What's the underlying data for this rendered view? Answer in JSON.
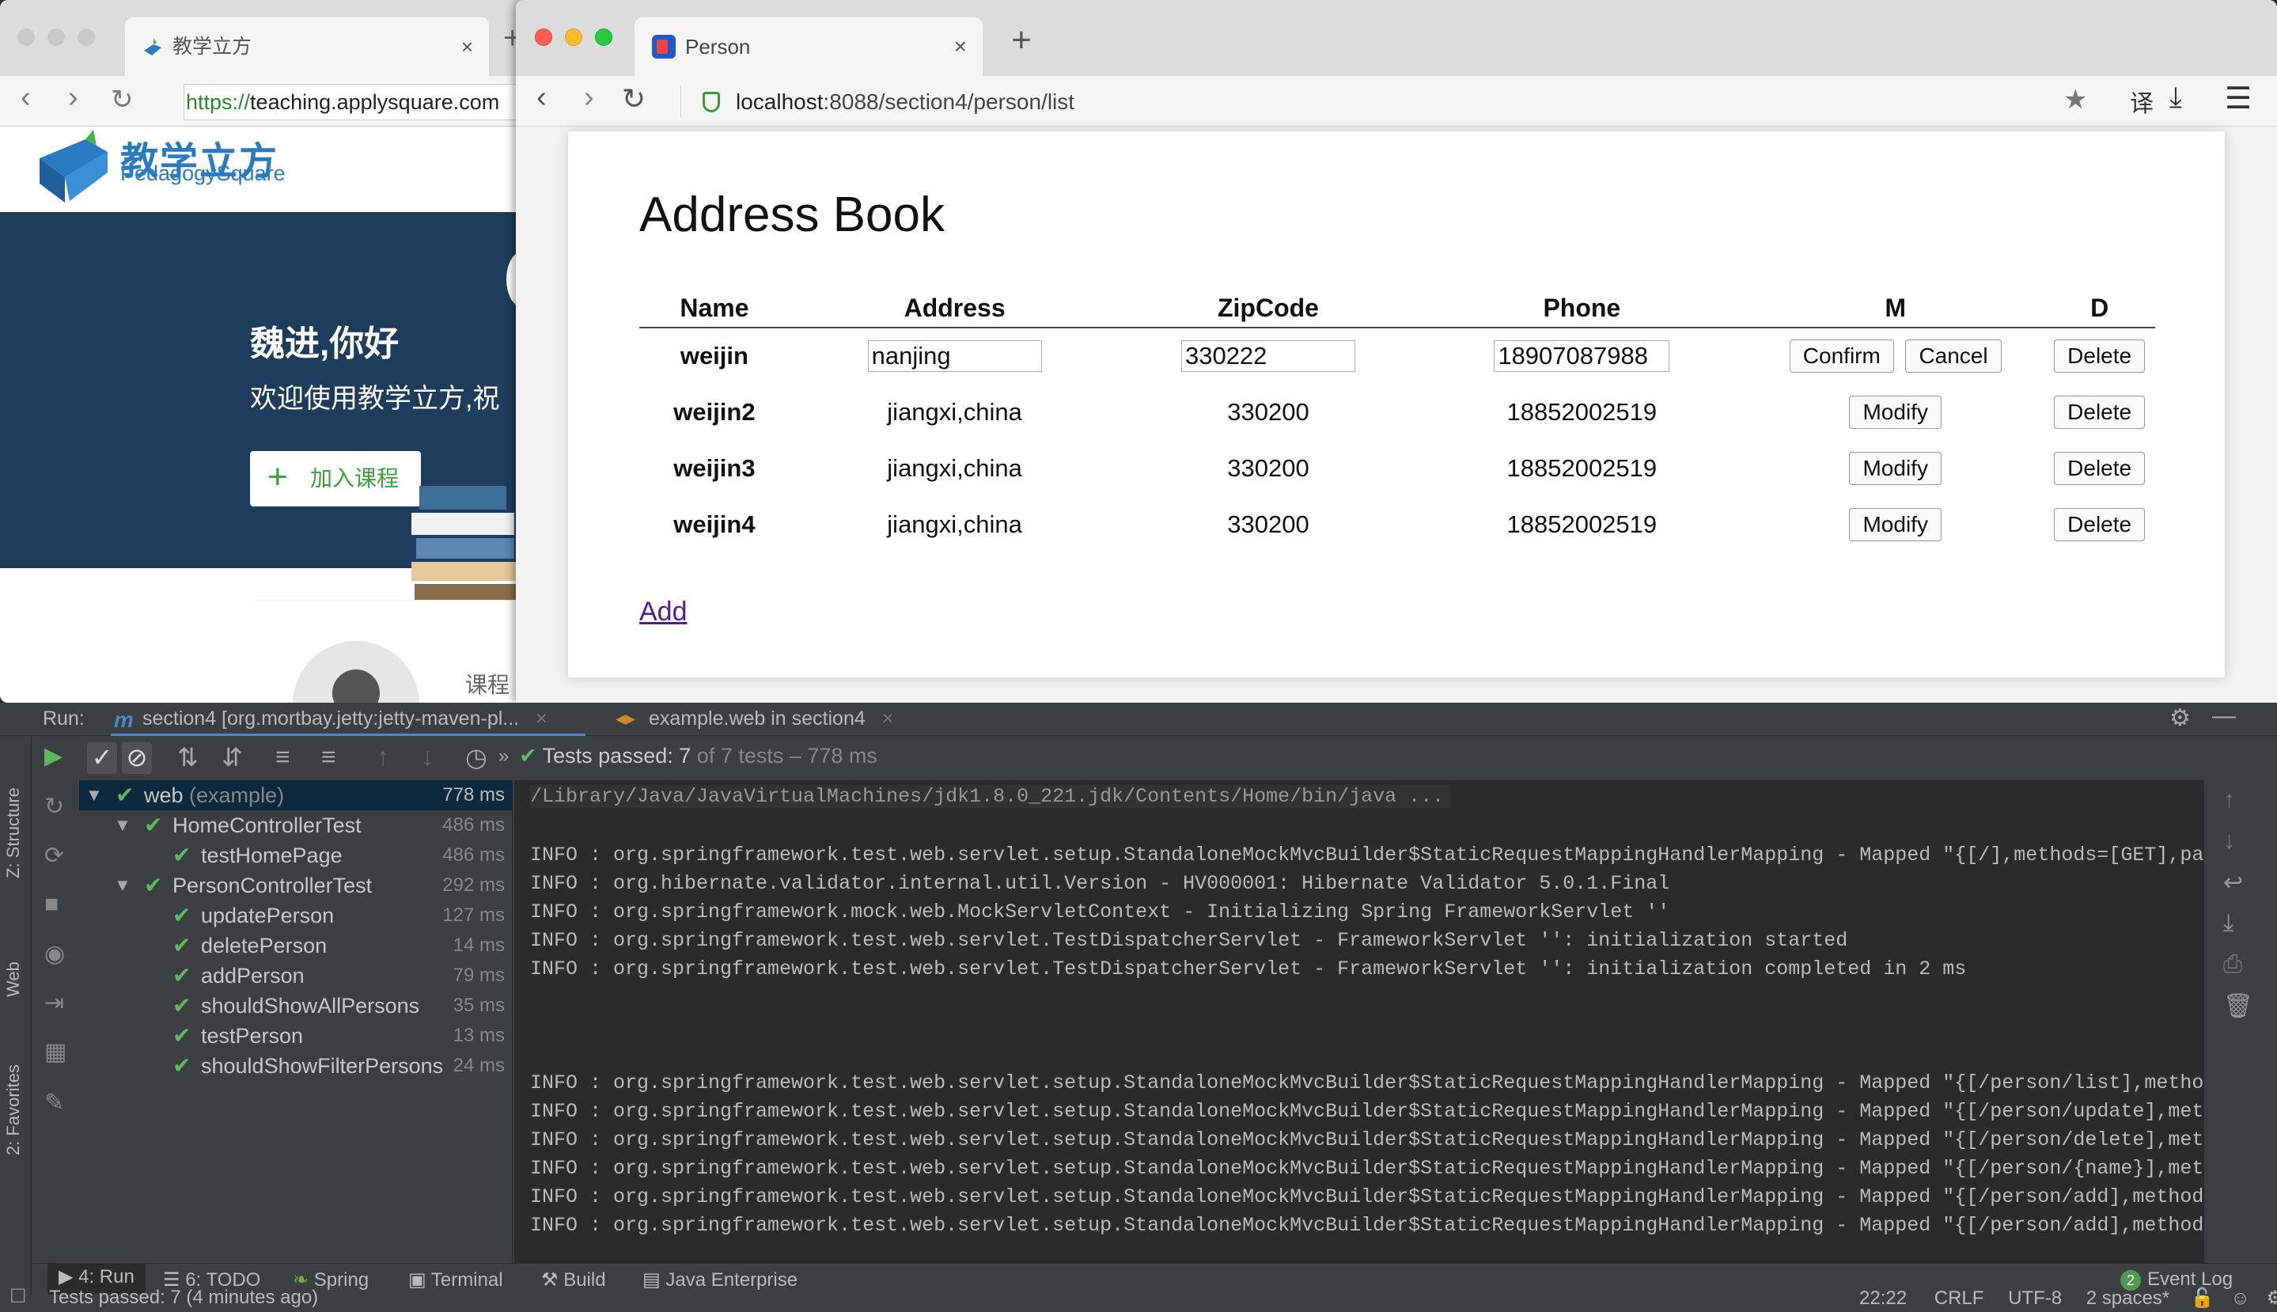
{
  "back_browser": {
    "tab_title": "教学立方",
    "tab_close": "×",
    "url_protocol": "https://",
    "url_rest": "teaching.applysquare.com",
    "logo_cn": "教学立方",
    "logo_en": "PedagogySquare",
    "greeting": "魏进,你好",
    "welcome": "欢迎使用教学立方,祝",
    "join_button": "加入课程",
    "course_label": "课程"
  },
  "front_browser": {
    "tab_title": "Person",
    "tab_close": "×",
    "new_tab": "+",
    "url_host": "localhost",
    "url_path": ":8088/section4/person/list",
    "translate_label": "译"
  },
  "address_book": {
    "title": "Address Book",
    "columns": [
      "Name",
      "Address",
      "ZipCode",
      "Phone",
      "M",
      "D"
    ],
    "editing_row": {
      "name": "weijin",
      "address": "nanjing",
      "zipcode": "330222",
      "phone": "18907087988",
      "confirm_label": "Confirm",
      "cancel_label": "Cancel",
      "delete_label": "Delete"
    },
    "rows": [
      {
        "name": "weijin2",
        "address": "jiangxi,china",
        "zipcode": "330200",
        "phone": "18852002519",
        "modify": "Modify",
        "delete": "Delete"
      },
      {
        "name": "weijin3",
        "address": "jiangxi,china",
        "zipcode": "330200",
        "phone": "18852002519",
        "modify": "Modify",
        "delete": "Delete"
      },
      {
        "name": "weijin4",
        "address": "jiangxi,china",
        "zipcode": "330200",
        "phone": "18852002519",
        "modify": "Modify",
        "delete": "Delete"
      }
    ],
    "add_link": "Add"
  },
  "ide": {
    "run_label": "Run:",
    "run_tab_1": "section4 [org.mortbay.jetty:jetty-maven-pl...",
    "run_tab_2": "example.web in section4",
    "tests_passed_label": "Tests passed:",
    "tests_passed_count": "7",
    "tests_passed_rest": "of 7 tests – 778 ms",
    "left_tabs": [
      "Z: Structure",
      "Web",
      "2: Favorites"
    ],
    "tree": [
      {
        "label": "web",
        "sub": " (example)",
        "duration": "778 ms",
        "level": 0,
        "expanded": true
      },
      {
        "label": "HomeControllerTest",
        "duration": "486 ms",
        "level": 1,
        "expanded": true
      },
      {
        "label": "testHomePage",
        "duration": "486 ms",
        "level": 2
      },
      {
        "label": "PersonControllerTest",
        "duration": "292 ms",
        "level": 1,
        "expanded": true
      },
      {
        "label": "updatePerson",
        "duration": "127 ms",
        "level": 2
      },
      {
        "label": "deletePerson",
        "duration": "14 ms",
        "level": 2
      },
      {
        "label": "addPerson",
        "duration": "79 ms",
        "level": 2
      },
      {
        "label": "shouldShowAllPersons",
        "duration": "35 ms",
        "level": 2
      },
      {
        "label": "testPerson",
        "duration": "13 ms",
        "level": 2
      },
      {
        "label": "shouldShowFilterPersons",
        "duration": "24 ms",
        "level": 2
      }
    ],
    "console_path": "/Library/Java/JavaVirtualMachines/jdk1.8.0_221.jdk/Contents/Home/bin/java ...",
    "console_block_1": [
      "INFO : org.springframework.test.web.servlet.setup.StandaloneMockMvcBuilder$StaticRequestMappingHandlerMapping - Mapped \"{[/],methods=[GET],params=[],he",
      "INFO : org.hibernate.validator.internal.util.Version - HV000001: Hibernate Validator 5.0.1.Final",
      "INFO : org.springframework.mock.web.MockServletContext - Initializing Spring FrameworkServlet ''",
      "INFO : org.springframework.test.web.servlet.TestDispatcherServlet - FrameworkServlet '': initialization started",
      "INFO : org.springframework.test.web.servlet.TestDispatcherServlet - FrameworkServlet '': initialization completed in 2 ms"
    ],
    "console_block_2": [
      "INFO : org.springframework.test.web.servlet.setup.StandaloneMockMvcBuilder$StaticRequestMappingHandlerMapping - Mapped \"{[/person/list],methods=[GET],p",
      "INFO : org.springframework.test.web.servlet.setup.StandaloneMockMvcBuilder$StaticRequestMappingHandlerMapping - Mapped \"{[/person/update],methods=[POST",
      "INFO : org.springframework.test.web.servlet.setup.StandaloneMockMvcBuilder$StaticRequestMappingHandlerMapping - Mapped \"{[/person/delete],methods=[POST",
      "INFO : org.springframework.test.web.servlet.setup.StandaloneMockMvcBuilder$StaticRequestMappingHandlerMapping - Mapped \"{[/person/{name}],methods=[GET]",
      "INFO : org.springframework.test.web.servlet.setup.StandaloneMockMvcBuilder$StaticRequestMappingHandlerMapping - Mapped \"{[/person/add],methods=[GET],pa",
      "INFO : org.springframework.test.web.servlet.setup.StandaloneMockMvcBuilder$StaticRequestMappingHandlerMapping - Mapped \"{[/person/add],methods=[POST],p"
    ],
    "bottom_tabs": {
      "run": "4: Run",
      "todo": "6: TODO",
      "spring": "Spring",
      "terminal": "Terminal",
      "build": "Build",
      "java_enterprise": "Java Enterprise",
      "event_log_count": "2",
      "event_log": "Event Log"
    },
    "status": {
      "message": "Tests passed: 7 (4 minutes ago)",
      "position": "22:22",
      "line_sep": "CRLF",
      "encoding": "UTF-8",
      "indent": "2 spaces*"
    }
  },
  "colors": {
    "pass_green": "#5fb85f",
    "brand_blue": "#2a7ac3",
    "hero_navy": "#1e3d5c",
    "ide_bg": "#3c3f41",
    "console_bg": "#2b2b2b"
  }
}
